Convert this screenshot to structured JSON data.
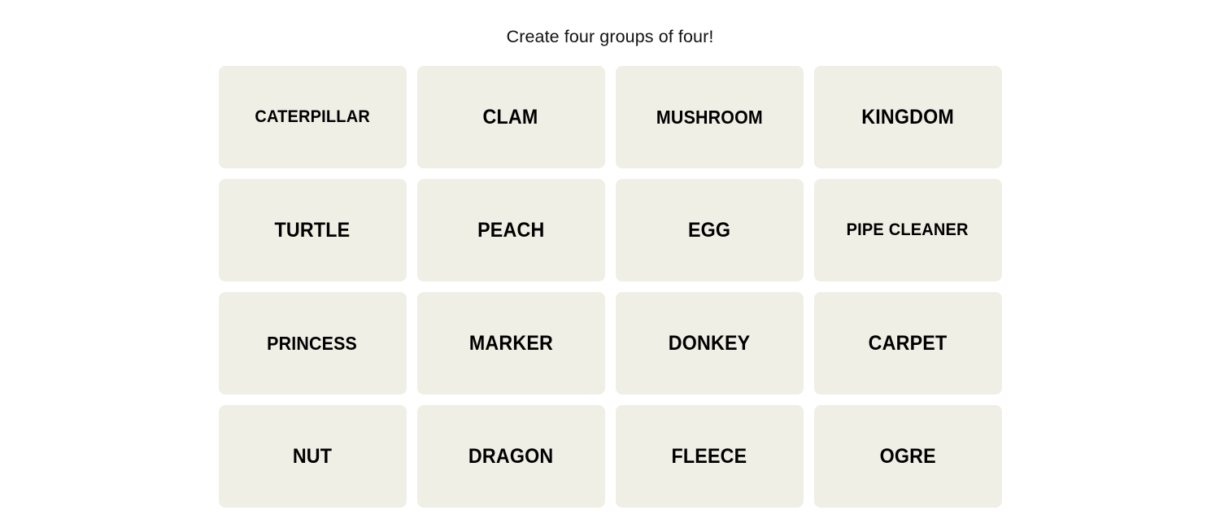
{
  "board": {
    "title": "Create four groups of four!",
    "colors": {
      "page_background": "#FFFFFF",
      "tile_background": "#EFEFE6",
      "tile_text": "#000000",
      "title_text": "#121212"
    },
    "rows": [
      [
        {
          "word": "CATERPILLAR"
        },
        {
          "word": "CLAM"
        },
        {
          "word": "MUSHROOM"
        },
        {
          "word": "KINGDOM"
        }
      ],
      [
        {
          "word": "TURTLE"
        },
        {
          "word": "PEACH"
        },
        {
          "word": "EGG"
        },
        {
          "word": "PIPE CLEANER"
        }
      ],
      [
        {
          "word": "PRINCESS"
        },
        {
          "word": "MARKER"
        },
        {
          "word": "DONKEY"
        },
        {
          "word": "CARPET"
        }
      ],
      [
        {
          "word": "NUT"
        },
        {
          "word": "DRAGON"
        },
        {
          "word": "FLEECE"
        },
        {
          "word": "OGRE"
        }
      ]
    ]
  }
}
